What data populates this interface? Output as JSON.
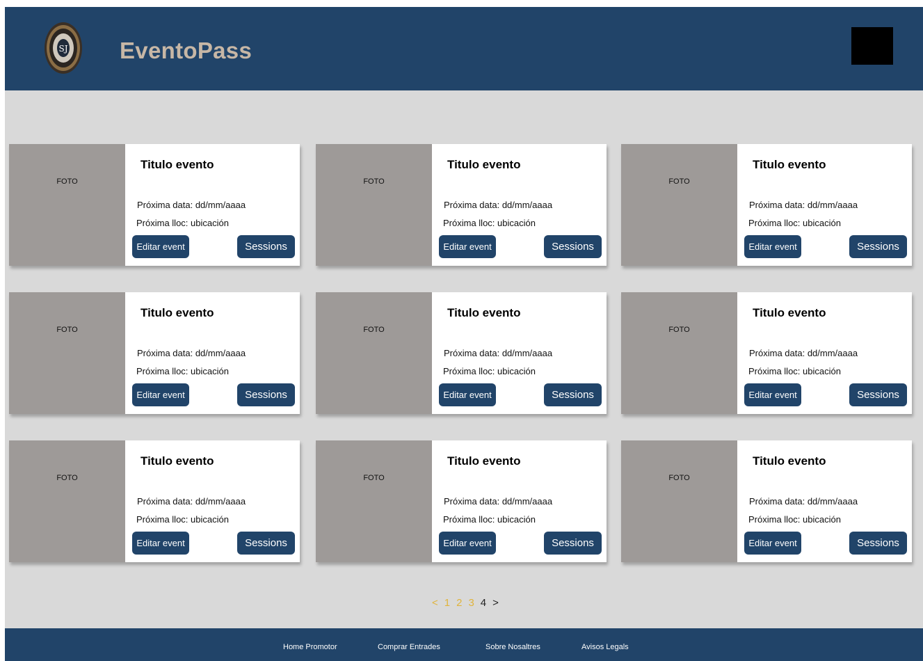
{
  "header": {
    "brand": "EventoPass"
  },
  "events": [
    {
      "photo_label": "FOTO",
      "title": "Titulo evento",
      "date_text": "Próxima data: dd/mm/aaaa",
      "place_text": "Próxima lloc: ubicación",
      "edit_label": "Editar event",
      "sessions_label": "Sessions"
    },
    {
      "photo_label": "FOTO",
      "title": "Titulo evento",
      "date_text": "Próxima data: dd/mm/aaaa",
      "place_text": "Próxima lloc: ubicación",
      "edit_label": "Editar event",
      "sessions_label": "Sessions"
    },
    {
      "photo_label": "FOTO",
      "title": "Titulo evento",
      "date_text": "Próxima data: dd/mm/aaaa",
      "place_text": "Próxima lloc: ubicación",
      "edit_label": "Editar event",
      "sessions_label": "Sessions"
    },
    {
      "photo_label": "FOTO",
      "title": "Titulo evento",
      "date_text": "Próxima data: dd/mm/aaaa",
      "place_text": "Próxima lloc: ubicación",
      "edit_label": "Editar event",
      "sessions_label": "Sessions"
    },
    {
      "photo_label": "FOTO",
      "title": "Titulo evento",
      "date_text": "Próxima data: dd/mm/aaaa",
      "place_text": "Próxima lloc: ubicación",
      "edit_label": "Editar event",
      "sessions_label": "Sessions"
    },
    {
      "photo_label": "FOTO",
      "title": "Titulo evento",
      "date_text": "Próxima data: dd/mm/aaaa",
      "place_text": "Próxima lloc: ubicación",
      "edit_label": "Editar event",
      "sessions_label": "Sessions"
    },
    {
      "photo_label": "FOTO",
      "title": "Titulo evento",
      "date_text": "Próxima data: dd/mm/aaaa",
      "place_text": "Próxima lloc: ubicación",
      "edit_label": "Editar event",
      "sessions_label": "Sessions"
    },
    {
      "photo_label": "FOTO",
      "title": "Titulo evento",
      "date_text": "Próxima data: dd/mm/aaaa",
      "place_text": "Próxima lloc: ubicación",
      "edit_label": "Editar event",
      "sessions_label": "Sessions"
    },
    {
      "photo_label": "FOTO",
      "title": "Titulo evento",
      "date_text": "Próxima data: dd/mm/aaaa",
      "place_text": "Próxima lloc: ubicación",
      "edit_label": "Editar event",
      "sessions_label": "Sessions"
    }
  ],
  "pagination": {
    "prev": "<",
    "pages": [
      "1",
      "2",
      "3",
      "4"
    ],
    "current": "4",
    "next": ">"
  },
  "footer": {
    "links": [
      "Home Promotor",
      "Comprar Entrades",
      "Sobre Nosaltres",
      "Avisos Legals"
    ]
  },
  "colors": {
    "primary": "#214469",
    "brand_text": "#c7b7a6",
    "page_bg": "#d9d9d9",
    "photo_placeholder": "#9e9a98",
    "pagination_link": "#e0b43c"
  },
  "icons": {
    "logo": "seal-logo-icon",
    "user": "user-avatar-box"
  }
}
